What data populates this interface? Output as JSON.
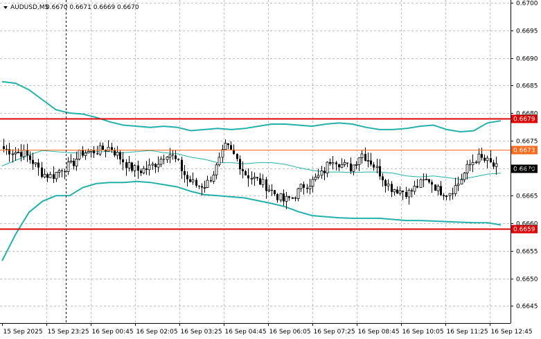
{
  "chart_data": {
    "type": "candlestick",
    "title": "AUDUSD,M5",
    "ohlc_text": "0.6670 0.6671 0.6669 0.6670",
    "ylim": [
      0.664,
      0.67
    ],
    "y_ticks": [
      "0.6700",
      "0.6695",
      "0.6690",
      "0.6685",
      "0.6680",
      "0.6675",
      "0.6670",
      "0.6665",
      "0.6660",
      "0.6655",
      "0.6650",
      "0.6645"
    ],
    "x_ticks": [
      "15 Sep 2025",
      "15 Sep 23:25",
      "16 Sep 00:45",
      "16 Sep 02:05",
      "16 Sep 03:25",
      "16 Sep 04:45",
      "16 Sep 06:05",
      "16 Sep 07:25",
      "16 Sep 08:45",
      "16 Sep 10:05",
      "16 Sep 11:25",
      "16 Sep 12:45"
    ],
    "grid": true,
    "horizontal_levels": [
      {
        "label": "0.6679",
        "value": 0.6679,
        "color": "#dc0000"
      },
      {
        "label": "0.6673",
        "value": 0.66733,
        "color": "#ff6a1a"
      },
      {
        "label": "0.6659",
        "value": 0.6659,
        "color": "#dc0000"
      }
    ],
    "current_price": {
      "label": "0.6670",
      "value": 0.667
    },
    "bollinger_upper": [
      0.66857,
      0.66854,
      0.66842,
      0.66824,
      0.66806,
      0.668,
      0.66798,
      0.66792,
      0.66784,
      0.66778,
      0.66776,
      0.66774,
      0.66776,
      0.66774,
      0.66768,
      0.6677,
      0.66772,
      0.6677,
      0.66772,
      0.66776,
      0.6678,
      0.6678,
      0.66778,
      0.66776,
      0.6678,
      0.66782,
      0.6678,
      0.66774,
      0.6677,
      0.6677,
      0.66772,
      0.66776,
      0.66778,
      0.6677,
      0.66766,
      0.66768,
      0.66782,
      0.66786
    ],
    "bollinger_middle": [
      0.66704,
      0.66714,
      0.66724,
      0.66732,
      0.6673,
      0.66728,
      0.66727,
      0.6673,
      0.6673,
      0.66728,
      0.6673,
      0.66732,
      0.66728,
      0.66726,
      0.6672,
      0.66716,
      0.6671,
      0.6671,
      0.66708,
      0.6671,
      0.6671,
      0.66707,
      0.66701,
      0.66696,
      0.66693,
      0.66693,
      0.66692,
      0.66693,
      0.66693,
      0.66691,
      0.66686,
      0.66684,
      0.66686,
      0.66683,
      0.6668,
      0.66684,
      0.66689,
      0.66691
    ],
    "bollinger_lower": [
      0.66532,
      0.6658,
      0.6662,
      0.6664,
      0.6665,
      0.6665,
      0.66665,
      0.66672,
      0.66674,
      0.66674,
      0.66676,
      0.66674,
      0.6667,
      0.66666,
      0.66658,
      0.66652,
      0.6665,
      0.66648,
      0.66646,
      0.66641,
      0.66636,
      0.6663,
      0.66621,
      0.66614,
      0.66612,
      0.6661,
      0.66609,
      0.66609,
      0.66609,
      0.66607,
      0.66605,
      0.66605,
      0.66604,
      0.66603,
      0.66602,
      0.66601,
      0.66601,
      0.66597
    ],
    "candle_anchors": [
      0.66735,
      0.6673,
      0.66728,
      0.66712,
      0.6669,
      0.66685,
      0.667,
      0.66705,
      0.66728,
      0.6673,
      0.66732,
      0.66738,
      0.6672,
      0.66702,
      0.66695,
      0.667,
      0.66712,
      0.6673,
      0.6671,
      0.6668,
      0.66668,
      0.6667,
      0.667,
      0.6674,
      0.6672,
      0.6669,
      0.6668,
      0.6667,
      0.66655,
      0.6664,
      0.66648,
      0.66668,
      0.66676,
      0.6669,
      0.6672,
      0.66706,
      0.667,
      0.66728,
      0.66712,
      0.6669,
      0.66665,
      0.6666,
      0.66655,
      0.6667,
      0.6668,
      0.6666,
      0.66655,
      0.6667,
      0.667,
      0.6672,
      0.66712,
      0.667
    ],
    "colors": {
      "background": "#ffffff",
      "bollinger": "#20b2aa",
      "candles": "#000000",
      "grid": "#c0c0c0"
    }
  }
}
